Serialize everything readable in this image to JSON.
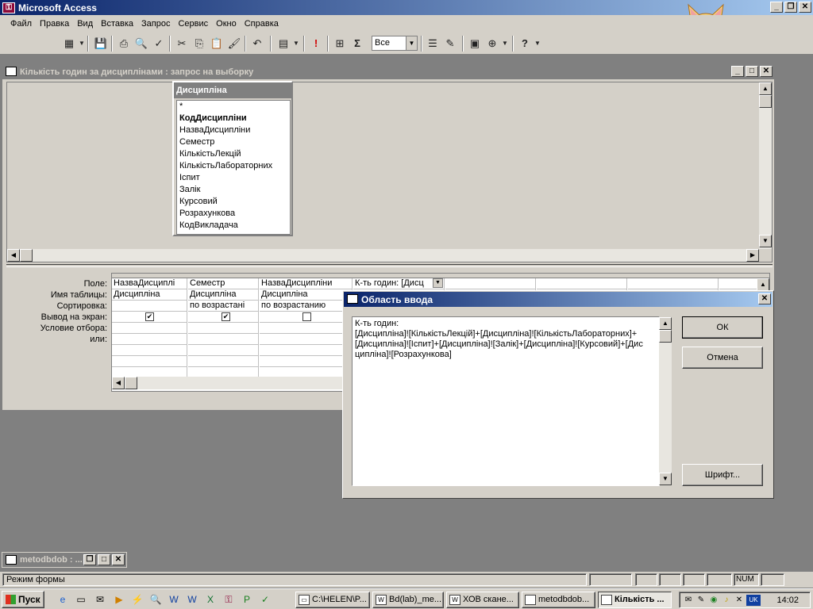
{
  "app": {
    "title": "Microsoft Access"
  },
  "menu": [
    "Файл",
    "Правка",
    "Вид",
    "Вставка",
    "Запрос",
    "Сервис",
    "Окно",
    "Справка"
  ],
  "toolbar": {
    "top_values": "Все"
  },
  "query_window": {
    "title": "Кількість годин за дисциплінами : запрос на выборку"
  },
  "table": {
    "name": "Дисципліна",
    "fields": [
      "*",
      "КодДисципліни",
      "НазваДисципліни",
      "Семестр",
      "КількістьЛекцій",
      "КількістьЛабораторних",
      "Іспит",
      "Залік",
      "Курсовий",
      "Розрахункова",
      "КодВикладача"
    ],
    "key_field": "КодДисципліни"
  },
  "grid": {
    "row_labels": [
      "Поле:",
      "Имя таблицы:",
      "Сортировка:",
      "Вывод на экран:",
      "Условие отбора:",
      "или:"
    ],
    "columns": [
      {
        "field": "НазваДисциплі",
        "table": "Дисципліна",
        "sort": "",
        "show": true
      },
      {
        "field": "Семестр",
        "table": "Дисципліна",
        "sort": "по возрастані",
        "show": true
      },
      {
        "field": "НазваДисципліни",
        "table": "Дисципліна",
        "sort": "по возрастанию",
        "show": false
      },
      {
        "field": "К-ть годин: [Дисц",
        "table": "",
        "sort": "",
        "show": null
      }
    ]
  },
  "zoom_dialog": {
    "title": "Область ввода",
    "text": "К-ть годин:\n[Дисципліна]![КількістьЛекцій]+[Дисципліна]![КількістьЛабораторних]+[Дисципліна]![Іспит]+[Дисципліна]![Залік]+[Дисципліна]![Курсовий]+[Дисципліна]![Розрахункова]",
    "ok": "ОК",
    "cancel": "Отмена",
    "font": "Шрифт..."
  },
  "minimized_window": {
    "title": "metodbdob : ..."
  },
  "status": {
    "text": "Режим формы",
    "num": "NUM"
  },
  "taskbar": {
    "start": "Пуск",
    "tasks": [
      "C:\\HELEN\\P...",
      "Bd(lab)_me...",
      "ХОВ скане...",
      "metodbdob...",
      "Кількість ..."
    ],
    "clock": "14:02",
    "lang": "UK"
  }
}
